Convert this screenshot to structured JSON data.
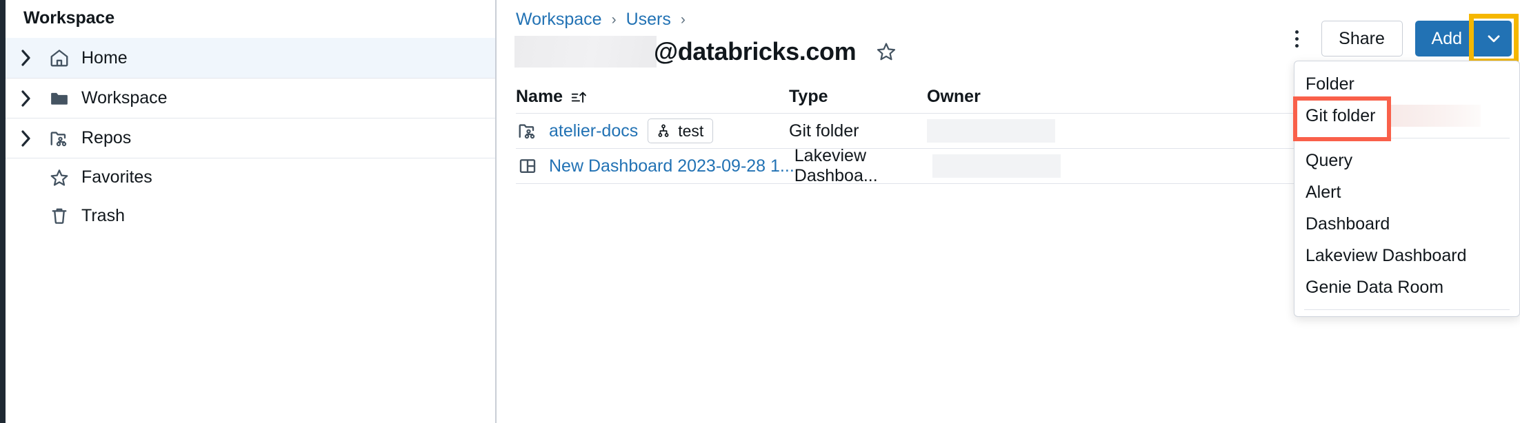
{
  "sidebar": {
    "title": "Workspace",
    "items": [
      {
        "label": "Home",
        "icon": "home-icon",
        "expandable": true,
        "active": true
      },
      {
        "label": "Workspace",
        "icon": "folder-icon",
        "expandable": true,
        "active": false
      },
      {
        "label": "Repos",
        "icon": "repo-folder-icon",
        "expandable": true,
        "active": false
      },
      {
        "label": "Favorites",
        "icon": "star-icon",
        "expandable": false,
        "active": false
      },
      {
        "label": "Trash",
        "icon": "trash-icon",
        "expandable": false,
        "active": false
      }
    ]
  },
  "breadcrumb": {
    "items": [
      "Workspace",
      "Users"
    ],
    "separator": "›",
    "trailing_separator": "›"
  },
  "header": {
    "redacted_user": "",
    "title": "@databricks.com",
    "star_icon": "star-outline-icon",
    "kebab_icon": "more-vertical-icon",
    "share_label": "Share",
    "add_label": "Add",
    "add_caret_icon": "chevron-down-icon"
  },
  "table": {
    "columns": [
      "Name",
      "Type",
      "Owner"
    ],
    "sort_icon": "sort-ascending-icon",
    "rows": [
      {
        "icon": "git-folder-icon",
        "name": "atelier-docs",
        "branch_icon": "git-branch-icon",
        "branch": "test",
        "type": "Git folder",
        "owner": ""
      },
      {
        "icon": "dashboard-icon",
        "name": "New Dashboard 2023-09-28 1...",
        "branch_icon": "",
        "branch": "",
        "type": "Lakeview Dashboa...",
        "owner": ""
      }
    ]
  },
  "add_menu": {
    "groups": [
      {
        "items": [
          {
            "label": "Folder",
            "highlighted": false
          },
          {
            "label": "Git folder",
            "highlighted": true
          }
        ]
      },
      {
        "items": [
          {
            "label": "Query",
            "highlighted": false
          },
          {
            "label": "Alert",
            "highlighted": false
          },
          {
            "label": "Dashboard",
            "highlighted": false
          },
          {
            "label": "Lakeview Dashboard",
            "highlighted": false
          },
          {
            "label": "Genie Data Room",
            "highlighted": false
          }
        ]
      }
    ]
  },
  "colors": {
    "accent_blue": "#2272b4",
    "link_blue": "#2272b4",
    "highlight_yellow": "#f5b700",
    "highlight_red": "#f9604a",
    "active_row": "#f0f6fc",
    "text_primary": "#11171c",
    "border": "#e0e3ea"
  }
}
